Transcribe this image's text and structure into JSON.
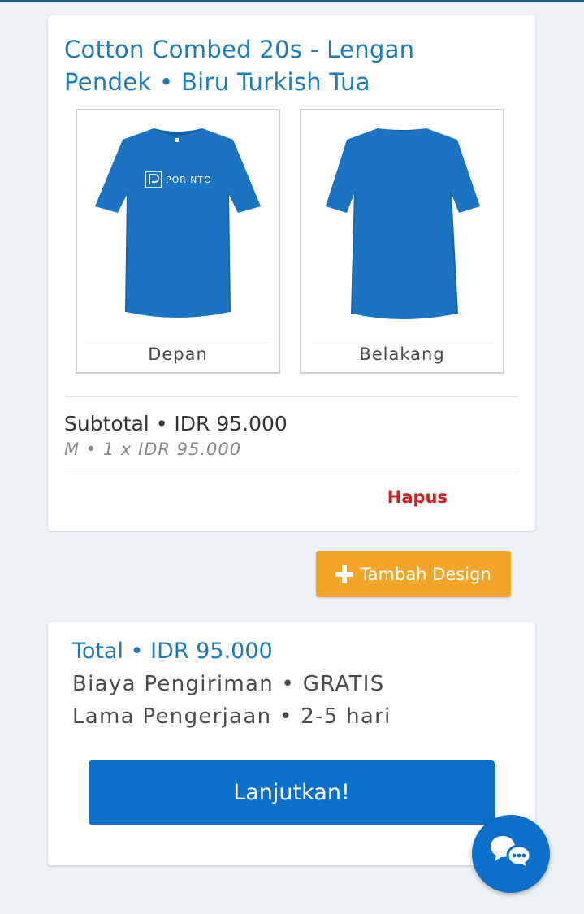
{
  "product": {
    "title": "Cotton Combed 20s - Lengan Pendek • Biru Turkish Tua",
    "shirt_color": "#1a73c3",
    "front": {
      "label": "Depan",
      "logo_text": "PORINTO"
    },
    "back": {
      "label": "Belakang"
    },
    "subtotal": "Subtotal • IDR 95.000",
    "order_detail": "M • 1 x IDR 95.000",
    "remove_label": "Hapus"
  },
  "actions": {
    "add_design_label": "Tambah Design",
    "add_icon": "plus-icon"
  },
  "summary": {
    "total": "Total • IDR 95.000",
    "shipping": "Biaya Pengiriman • GRATIS",
    "production_time": "Lama Pengerjaan • 2-5 hari",
    "continue_label": "Lanjutkan!"
  },
  "chat": {
    "icon": "chat-bubbles-icon"
  },
  "colors": {
    "accent_blue": "#1e7bb5",
    "primary_button": "#0b6fcc",
    "secondary_button": "#f2a526",
    "danger": "#cc1f1f"
  }
}
